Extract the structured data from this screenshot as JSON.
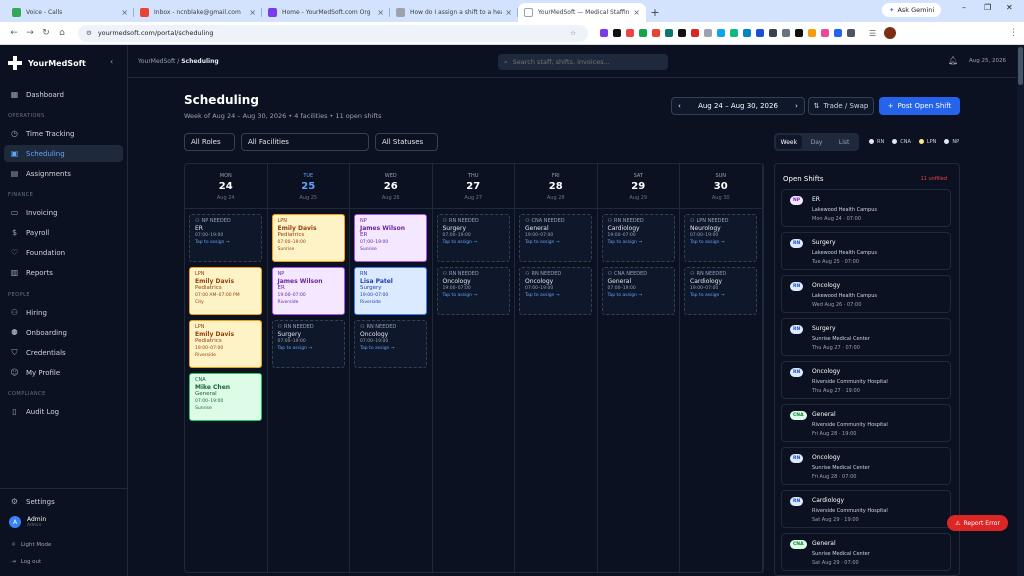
{
  "browser": {
    "tabs": [
      {
        "title": "Voice - Calls",
        "color": "#34a853"
      },
      {
        "title": "Inbox - ncnblake@gmail.com",
        "color": "#ea4335"
      },
      {
        "title": "Home - YourMedSoft.com Org",
        "color": "#7c3aed"
      },
      {
        "title": "How do I assign a shift to a hea",
        "color": "#9ca3af"
      },
      {
        "title": "YourMedSoft — Medical Staffin",
        "color": "#ffffff"
      }
    ],
    "url": "yourmedsoft.com/portal/scheduling",
    "gemini_label": "Ask Gemini"
  },
  "sidebar": {
    "brand": "YourMedSoft",
    "dashboard": "Dashboard",
    "operations_heading": "OPERATIONS",
    "operations": [
      "Time Tracking",
      "Scheduling",
      "Assignments"
    ],
    "finance_heading": "FINANCE",
    "finance": [
      "Invoicing",
      "Payroll",
      "Foundation",
      "Reports"
    ],
    "people_heading": "PEOPLE",
    "people": [
      "Hiring",
      "Onboarding",
      "Credentials",
      "My Profile"
    ],
    "compliance_heading": "COMPLIANCE",
    "compliance": [
      "Audit Log"
    ],
    "settings": "Settings",
    "user_initial": "A",
    "user_name": "Admin",
    "user_role": "Admin",
    "light_mode": "Light Mode",
    "logout": "Log out"
  },
  "topbar": {
    "crumb_root": "YourMedSoft",
    "crumb_sep": "/",
    "crumb_current": "Scheduling",
    "search_placeholder": "Search staff, shifts, invoices...",
    "date": "Aug 25, 2026"
  },
  "header": {
    "title": "Scheduling",
    "subtitle": "Week of Aug 24 – Aug 30, 2026 • 4 facilities • 11 open shifts",
    "range": "Aug 24 – Aug 30, 2026",
    "trade_label": "Trade / Swap",
    "post_label": "Post Open Shift"
  },
  "filters": {
    "roles": "All Roles",
    "facilities": "All Facilities",
    "statuses": "All Statuses",
    "views": [
      "Week",
      "Day",
      "List"
    ],
    "legend": [
      {
        "label": "RN",
        "color": "#e2e8f0"
      },
      {
        "label": "CNA",
        "color": "#e2e8f0"
      },
      {
        "label": "LPN",
        "color": "#fde68a"
      },
      {
        "label": "NP",
        "color": "#e2e8f0"
      }
    ]
  },
  "calendar": {
    "days": [
      {
        "dow": "MON",
        "num": "24",
        "date": "Aug 24"
      },
      {
        "dow": "TUE",
        "num": "25",
        "date": "Aug 25"
      },
      {
        "dow": "WED",
        "num": "26",
        "date": "Aug 26"
      },
      {
        "dow": "THU",
        "num": "27",
        "date": "Aug 27"
      },
      {
        "dow": "FRI",
        "num": "28",
        "date": "Aug 28"
      },
      {
        "dow": "SAT",
        "num": "29",
        "date": "Aug 29"
      },
      {
        "dow": "SUN",
        "num": "30",
        "date": "Aug 30"
      }
    ],
    "tap_label": "Tap to assign →",
    "cards": [
      {
        "col": 0,
        "row": 0,
        "kind": "open",
        "role": "NP NEEDED",
        "unit": "ER",
        "time": "07:00–19:00"
      },
      {
        "col": 0,
        "row": 1,
        "kind": "lpn",
        "role": "LPN",
        "name": "Emily Davis",
        "unit": "Pediatrics",
        "time": "07:00 AM–07:00 PM",
        "facility": "City"
      },
      {
        "col": 0,
        "row": 2,
        "kind": "lpn",
        "role": "LPN",
        "name": "Emily Davis",
        "unit": "Pediatrics",
        "time": "19:00–07:00",
        "facility": "Riverside"
      },
      {
        "col": 0,
        "row": 3,
        "kind": "cna",
        "role": "CNA",
        "name": "Mike Chen",
        "unit": "General",
        "time": "07:00–19:00",
        "facility": "Sunrise"
      },
      {
        "col": 1,
        "row": 0,
        "kind": "lpn",
        "role": "LPN",
        "name": "Emily Davis",
        "unit": "Pediatrics",
        "time": "07:00–19:00",
        "facility": "Sunrise"
      },
      {
        "col": 1,
        "row": 1,
        "kind": "np",
        "role": "NP",
        "name": "James Wilson",
        "unit": "ER",
        "time": "19:00–07:00",
        "facility": "Riverside"
      },
      {
        "col": 1,
        "row": 2,
        "kind": "open",
        "role": "RN NEEDED",
        "unit": "Surgery",
        "time": "07:00–19:00"
      },
      {
        "col": 2,
        "row": 0,
        "kind": "np",
        "role": "NP",
        "name": "James Wilson",
        "unit": "ER",
        "time": "07:00–19:00",
        "facility": "Sunrise"
      },
      {
        "col": 2,
        "row": 1,
        "kind": "rn",
        "role": "RN",
        "name": "Lisa Patel",
        "unit": "Surgery",
        "time": "19:00–07:00",
        "facility": "Riverside"
      },
      {
        "col": 2,
        "row": 2,
        "kind": "open",
        "role": "RN NEEDED",
        "unit": "Oncology",
        "time": "07:00–19:00"
      },
      {
        "col": 3,
        "row": 0,
        "kind": "open",
        "role": "RN NEEDED",
        "unit": "Surgery",
        "time": "07:00–19:00"
      },
      {
        "col": 3,
        "row": 1,
        "kind": "open",
        "role": "RN NEEDED",
        "unit": "Oncology",
        "time": "19:00–07:00"
      },
      {
        "col": 4,
        "row": 0,
        "kind": "open",
        "role": "CNA NEEDED",
        "unit": "General",
        "time": "19:00–07:00"
      },
      {
        "col": 4,
        "row": 1,
        "kind": "open",
        "role": "RN NEEDED",
        "unit": "Oncology",
        "time": "07:00–19:00"
      },
      {
        "col": 5,
        "row": 0,
        "kind": "open",
        "role": "RN NEEDED",
        "unit": "Cardiology",
        "time": "19:00–07:00"
      },
      {
        "col": 5,
        "row": 1,
        "kind": "open",
        "role": "CNA NEEDED",
        "unit": "General",
        "time": "07:00–19:00"
      },
      {
        "col": 6,
        "row": 0,
        "kind": "open",
        "role": "LPN NEEDED",
        "unit": "Neurology",
        "time": "07:00–19:00"
      },
      {
        "col": 6,
        "row": 1,
        "kind": "open",
        "role": "RN NEEDED",
        "unit": "Cardiology",
        "time": "19:00–07:00"
      }
    ]
  },
  "open_shifts": {
    "title": "Open Shifts",
    "unfilled": "11 unfilled",
    "items": [
      {
        "badge": "NP",
        "unit": "ER",
        "facility": "Lakewood Health Campus",
        "when": "Mon Aug 24 · 07:00"
      },
      {
        "badge": "RN",
        "unit": "Surgery",
        "facility": "Lakewood Health Campus",
        "when": "Tue Aug 25 · 07:00"
      },
      {
        "badge": "RN",
        "unit": "Oncology",
        "facility": "Lakewood Health Campus",
        "when": "Wed Aug 26 · 07:00"
      },
      {
        "badge": "RN",
        "unit": "Surgery",
        "facility": "Sunrise Medical Center",
        "when": "Thu Aug 27 · 07:00"
      },
      {
        "badge": "RN",
        "unit": "Oncology",
        "facility": "Riverside Community Hospital",
        "when": "Thu Aug 27 · 19:00"
      },
      {
        "badge": "CNA",
        "unit": "General",
        "facility": "Riverside Community Hospital",
        "when": "Fri Aug 28 · 19:00"
      },
      {
        "badge": "RN",
        "unit": "Oncology",
        "facility": "Sunrise Medical Center",
        "when": "Fri Aug 28 · 07:00"
      },
      {
        "badge": "RN",
        "unit": "Cardiology",
        "facility": "Riverside Community Hospital",
        "when": "Sat Aug 29 · 19:00"
      },
      {
        "badge": "CNA",
        "unit": "General",
        "facility": "Sunrise Medical Center",
        "when": "Sat Aug 29 · 07:00"
      }
    ]
  },
  "report_label": "Report Error"
}
